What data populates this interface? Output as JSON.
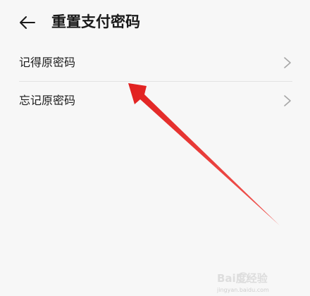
{
  "header": {
    "title": "重置支付密码",
    "back_icon": "arrow-left-icon"
  },
  "list": {
    "items": [
      {
        "label": "记得原密码",
        "icon": "chevron-right-icon"
      },
      {
        "label": "忘记原密码",
        "icon": "chevron-right-icon"
      }
    ]
  },
  "annotation": {
    "arrow_color": "#e8302f",
    "points_to": "记得原密码"
  },
  "watermark": {
    "brand": "Bai度经验",
    "url": "jingyan.baidu.com"
  },
  "colors": {
    "background": "#f7f7f7",
    "text": "#1b1b1b",
    "chevron": "#a6a6a6",
    "divider": "#e2e2e2"
  }
}
